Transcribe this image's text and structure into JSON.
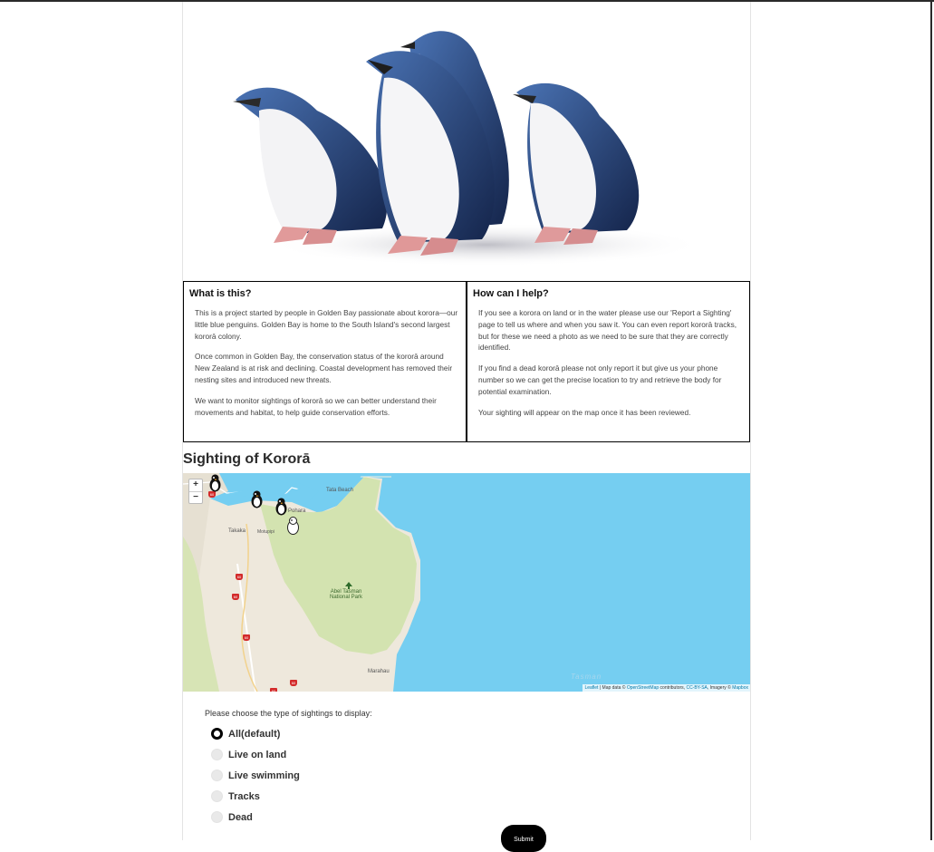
{
  "info": {
    "what": {
      "heading": "What is this?",
      "paragraphs": [
        "This is a project started by people in Golden Bay passionate about korora—our little blue penguins. Golden Bay is home to the South Island's second largest kororā colony.",
        "Once common in Golden Bay, the conservation status of the kororā around New Zealand is at risk and declining. Coastal development has removed their nesting sites and introduced new threats.",
        "We want to monitor sightings of kororā so we can better understand their movements and habitat, to help guide conservation efforts."
      ]
    },
    "help": {
      "heading": "How can I help?",
      "paragraphs": [
        "If you see a korora on land or in the water please use our 'Report a Sighting' page to tell us where and when you saw it. You can even report kororā tracks, but for these we need a photo as we need to be sure that they are correctly identified.",
        "If you find a dead kororā please not only report it but give us your phone number so we can get the precise location to try and retrieve the body for potential examination.",
        "Your sighting will appear on the map once it has been reviewed."
      ]
    }
  },
  "map": {
    "title": "Sighting of Kororā",
    "zoom_in": "+",
    "zoom_out": "−",
    "places": {
      "pohara": "Pohara",
      "takaka": "Takaka",
      "motupipi": "Motupipi",
      "tata_beach": "Tata Beach",
      "park_line1": "Abel Tasman",
      "park_line2": "National Park",
      "marahau": "Marahau",
      "tasman": "Tasman"
    },
    "highway_label": "60",
    "attribution": {
      "leaflet": "Leaflet",
      "sep1": " | Map data © ",
      "osm": "OpenStreetMap",
      "sep2": " contributors, ",
      "license": "CC-BY-SA",
      "sep3": ", Imagery © ",
      "mapbox": "Mapbox"
    },
    "colors": {
      "sea": "#75cef1",
      "land": "#eee8dc",
      "forest": "#d3e3b0"
    }
  },
  "filters": {
    "prompt": "Please choose the type of sightings to display:",
    "options": [
      "All(default)",
      "Live on land",
      "Live swimming",
      "Tracks",
      "Dead"
    ],
    "selected": "All(default)"
  },
  "submit_label": "Submit"
}
